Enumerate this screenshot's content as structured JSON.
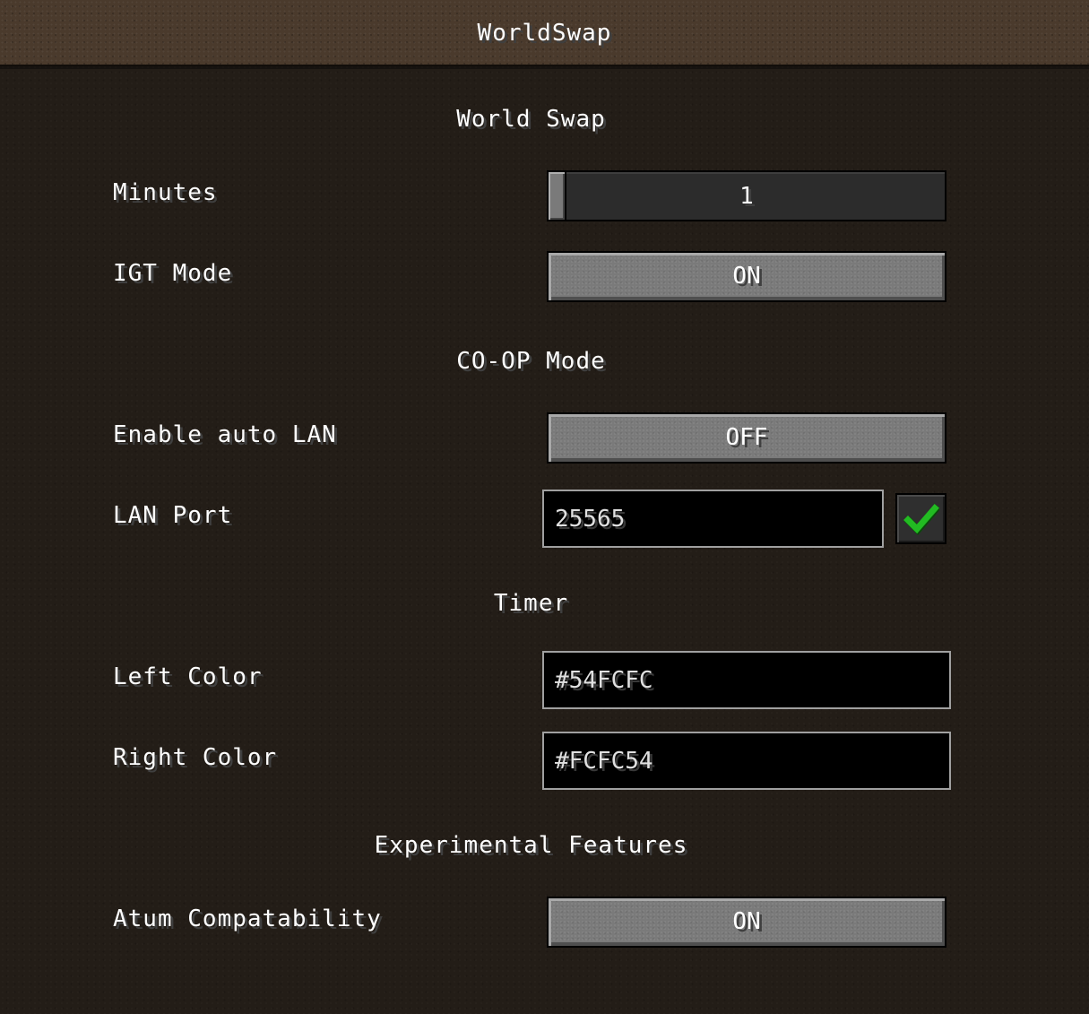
{
  "window": {
    "title": "WorldSwap"
  },
  "sections": {
    "world_swap": "World Swap",
    "coop_mode": "CO-OP Mode",
    "timer": "Timer",
    "experimental": "Experimental Features"
  },
  "options": {
    "minutes": {
      "label": "Minutes",
      "value": "1",
      "slider_position": 0.0
    },
    "igt_mode": {
      "label": "IGT Mode",
      "value": "ON"
    },
    "auto_lan": {
      "label": "Enable auto LAN",
      "value": "OFF"
    },
    "lan_port": {
      "label": "LAN Port",
      "value": "25565",
      "confirm_icon": "checkmark-icon"
    },
    "left_color": {
      "label": "Left Color",
      "value": "#54FCFC"
    },
    "right_color": {
      "label": "Right Color",
      "value": "#FCFC54"
    },
    "atum_compat": {
      "label": "Atum Compatability",
      "value": "ON"
    }
  },
  "colors": {
    "checkmark": "#22bb22",
    "text_shadow": "#3f3f3f"
  }
}
